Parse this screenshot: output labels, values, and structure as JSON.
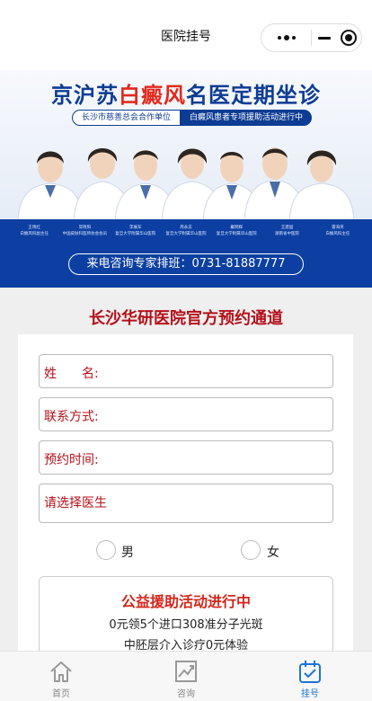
{
  "nav": {
    "title": "医院挂号"
  },
  "banner": {
    "headline_part1": "京沪苏",
    "headline_part2": "白癜风",
    "headline_part3": "名医定期坐诊",
    "tag_left": "长沙市慈善总会合作单位",
    "tag_right": "白癜风患者专项援助活动进行中",
    "doctor_names": [
      {
        "name": "王晓红",
        "title": "白癜风科副主任"
      },
      {
        "name": "常晓阳",
        "title": "中国皮肤科医师协会会员"
      },
      {
        "name": "李展军",
        "title": "复旦大学附属华山医院"
      },
      {
        "name": "周永志",
        "title": "复旦大学附属华山医院"
      },
      {
        "name": "戴明辉",
        "title": "复旦大学附属华山医院"
      },
      {
        "name": "王建国",
        "title": "湖南省中医院"
      },
      {
        "name": "雷海英",
        "title": "白癜风科主任"
      }
    ],
    "phone": "来电咨询专家排班：0731-81887777"
  },
  "form": {
    "title": "长沙华研医院官方预约通道",
    "name_label": "姓　　名:",
    "contact_label": "联系方式:",
    "time_label": "预约时间:",
    "doctor_label": "请选择医生",
    "gender_male": "男",
    "gender_female": "女"
  },
  "notice": {
    "title": "公益援助活动进行中",
    "line1": "0元领5个进口308准分子光斑",
    "line2": "中胚层介入诊疗0元体验"
  },
  "tabbar": {
    "items": [
      {
        "label": "首页",
        "icon": "home-icon"
      },
      {
        "label": "咨询",
        "icon": "chart-icon"
      },
      {
        "label": "挂号",
        "icon": "calendar-check-icon"
      }
    ],
    "active_index": 2,
    "accent": "#1e73d6"
  },
  "colors": {
    "brand_blue": "#0c3fa1",
    "brand_red": "#b3101a",
    "accent_red": "#e02a1d"
  }
}
